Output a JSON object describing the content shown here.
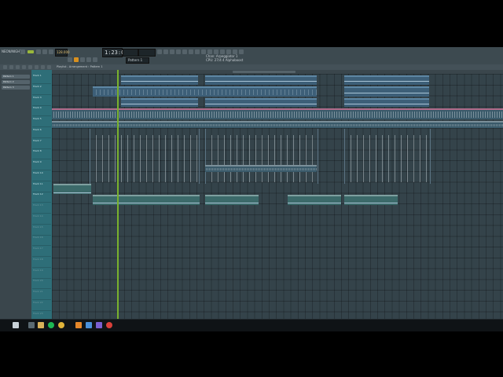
{
  "toolbar": {
    "song_name": "NEON/NIGHT",
    "time_display": "1:23:0",
    "pattern_label": "Pattern 1",
    "hint_line1": "Chan: Arpeggiator 1",
    "hint_line2": "CPU: 27/4  4 Alphaboost",
    "tempo": "128.000"
  },
  "playlist": {
    "title": "Playlist - Arrangement › Pattern 1"
  },
  "browser": {
    "patterns": [
      "Pattern 1",
      "Pattern 2",
      "Pattern 3"
    ]
  },
  "tracks": [
    "Track 1",
    "Track 2",
    "Track 3",
    "Track 4",
    "Track 5",
    "Track 6",
    "Track 7",
    "Track 8",
    "Track 9",
    "Track 10",
    "Track 11",
    "Track 12",
    "Track 13",
    "Track 14",
    "Track 15",
    "Track 16",
    "Track 17",
    "Track 18",
    "Track 19",
    "Track 20",
    "Track 21",
    "Track 22",
    "Track 23"
  ],
  "icons": {
    "taskbar": [
      "start-icon",
      "search-icon",
      "folder-icon",
      "spotify-icon",
      "chrome-icon",
      "fl-studio-icon",
      "explorer-icon",
      "store-icon",
      "opera-icon"
    ]
  }
}
